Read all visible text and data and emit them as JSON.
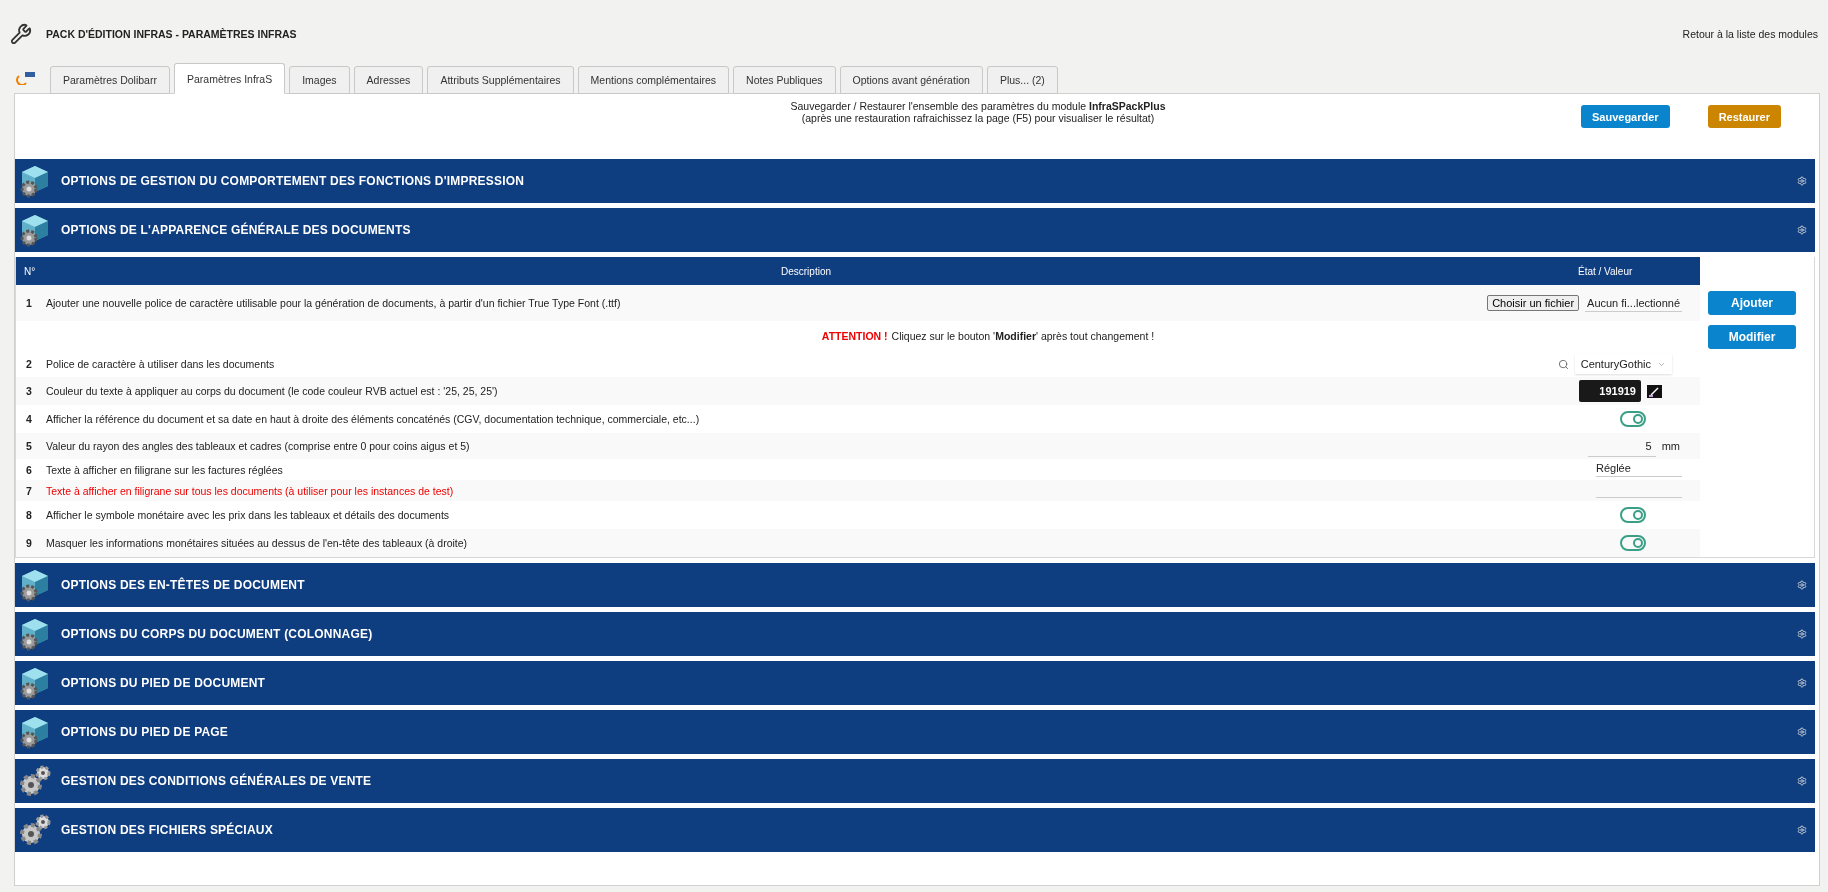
{
  "header": {
    "title": "PACK D'ÉDITION INFRAS - PARAMÈTRES INFRAS",
    "back_link": "Retour à la liste des modules"
  },
  "tabs": [
    {
      "label": "Paramètres Dolibarr",
      "selected": false
    },
    {
      "label": "Paramètres InfraS",
      "selected": true
    },
    {
      "label": "Images",
      "selected": false
    },
    {
      "label": "Adresses",
      "selected": false
    },
    {
      "label": "Attributs Supplémentaires",
      "selected": false
    },
    {
      "label": "Mentions complémentaires",
      "selected": false
    },
    {
      "label": "Notes Publiques",
      "selected": false
    },
    {
      "label": "Options avant génération",
      "selected": false
    },
    {
      "label": "Plus... (2)",
      "selected": false
    }
  ],
  "backup": {
    "line1": "Sauvegarder / Restaurer l'ensemble des paramètres du module **InfraSPackPlus**",
    "line2": "(après une restauration rafraichissez la page (F5) pour visualiser le résultat)",
    "save_button": "Sauvegarder",
    "restore_button": "Restaurer"
  },
  "sections_before": [
    {
      "title": "OPTIONS DE GESTION DU COMPORTEMENT DES FONCTIONS D'IMPRESSION",
      "kind": "cube"
    },
    {
      "title": "OPTIONS DE L'APPARENCE GÉNÉRALE DES DOCUMENTS",
      "kind": "cube"
    }
  ],
  "table": {
    "columns": [
      "N°",
      "Description",
      "État / Valeur"
    ],
    "rows": [
      {
        "kind": "file",
        "number": "1",
        "description": "Ajouter une nouvelle police de caractère utilisable pour la génération de documents, à partir d'un fichier True Type Font (.ttf)",
        "highlight": false,
        "file_button": "Choisir un fichier",
        "file_name": "Aucun fi...lectionné",
        "action": "Ajouter"
      },
      {
        "kind": "notice",
        "label": "ATTENTION !",
        "text": "Cliquez sur le bouton '**Modifier**' après tout changement !",
        "action": "Modifier"
      },
      {
        "kind": "select",
        "number": "2",
        "description": "Police de caractère à utiliser dans les documents",
        "highlight": false,
        "value": "CenturyGothic"
      },
      {
        "kind": "color",
        "number": "3",
        "description": "Couleur du texte à appliquer au corps du document (le code couleur RVB actuel est : '25, 25, 25')",
        "highlight": false,
        "value": "191919",
        "color": "#191919"
      },
      {
        "kind": "toggle",
        "number": "4",
        "description": "Afficher la référence du document et sa date en haut à droite des éléments concaténés (CGV, documentation technique, commerciale, etc...)",
        "highlight": false,
        "on": true
      },
      {
        "kind": "number",
        "number": "5",
        "description": "Valeur du rayon des angles des tableaux et cadres (comprise entre 0 pour coins aigus et 5)",
        "highlight": false,
        "value": "5",
        "unit": "mm"
      },
      {
        "kind": "text",
        "number": "6",
        "description": "Texte à afficher en filigrane sur les factures réglées",
        "highlight": false,
        "value": "Réglée"
      },
      {
        "kind": "text",
        "number": "7",
        "description": "Texte à afficher en filigrane sur tous les documents (à utiliser pour les instances de test)",
        "highlight": true
      },
      {
        "kind": "toggle",
        "number": "8",
        "description": "Afficher le symbole monétaire avec les prix dans les tableaux et détails des documents",
        "highlight": false,
        "on": true
      },
      {
        "kind": "toggle",
        "number": "9",
        "description": "Masquer les informations monétaires situées au dessus de l'en-tête des tableaux (à droite)",
        "highlight": false,
        "on": true
      }
    ]
  },
  "sections_after": [
    {
      "title": "OPTIONS DES EN-TÊTES DE DOCUMENT",
      "kind": "cube"
    },
    {
      "title": "OPTIONS DU CORPS DU DOCUMENT (COLONNAGE)",
      "kind": "cube"
    },
    {
      "title": "OPTIONS DU PIED DE DOCUMENT",
      "kind": "cube"
    },
    {
      "title": "OPTIONS DU PIED DE PAGE",
      "kind": "cube"
    },
    {
      "title": "GESTION DES CONDITIONS GÉNÉRALES DE VENTE",
      "kind": "gears"
    },
    {
      "title": "GESTION DES FICHIERS SPÉCIAUX",
      "kind": "gears"
    }
  ]
}
